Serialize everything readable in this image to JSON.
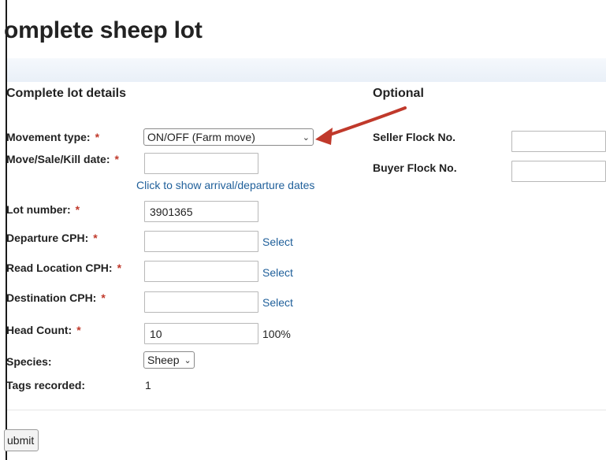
{
  "page": {
    "title": "omplete sheep lot"
  },
  "sections": {
    "details": "Complete lot details",
    "optional": "Optional"
  },
  "fields": {
    "movement_type": {
      "label": "Movement type:",
      "value": "ON/OFF (Farm move)"
    },
    "move_date": {
      "label": "Move/Sale/Kill date:",
      "value": ""
    },
    "dates_link": "Click to show arrival/departure dates",
    "lot_number": {
      "label": "Lot number:",
      "value": "3901365"
    },
    "departure_cph": {
      "label": "Departure CPH:",
      "value": "",
      "link": "Select"
    },
    "read_location_cph": {
      "label": "Read Location CPH:",
      "value": "",
      "link": "Select"
    },
    "destination_cph": {
      "label": "Destination CPH:",
      "value": "",
      "link": "Select"
    },
    "head_count": {
      "label": "Head Count:",
      "value": "10",
      "percent": "100%"
    },
    "species": {
      "label": "Species:",
      "value": "Sheep"
    },
    "tags_recorded": {
      "label": "Tags recorded:",
      "value": "1"
    }
  },
  "optional": {
    "seller_flock": {
      "label": "Seller Flock No.",
      "value": ""
    },
    "buyer_flock": {
      "label": "Buyer Flock No.",
      "value": ""
    }
  },
  "required_marker": "*",
  "submit_label": "ubmit",
  "colors": {
    "link": "#1f5f9a",
    "required": "#c0392b",
    "arrow": "#c0392b",
    "band": "#e9f0f8"
  },
  "icons": {
    "dropdown": "chevron-down-icon",
    "annotation": "red-arrow-annotation"
  }
}
